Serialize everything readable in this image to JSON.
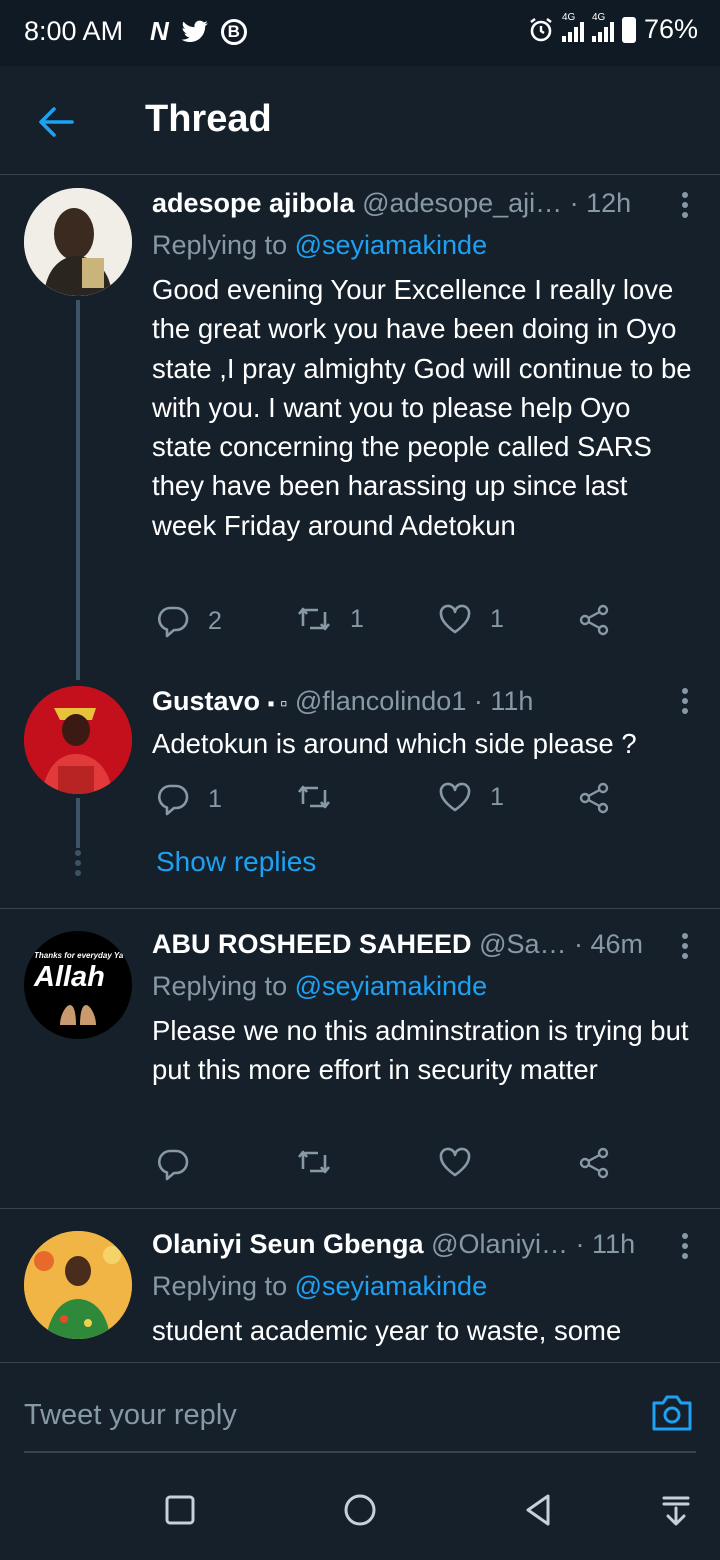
{
  "status_bar": {
    "time": "8:00 AM",
    "left_icons": [
      "news-icon",
      "twitter-icon",
      "b-icon"
    ],
    "signal_1_tag": "4G",
    "signal_2_tag": "4G",
    "battery": "76%"
  },
  "header": {
    "title": "Thread"
  },
  "tweets": [
    {
      "name": "adesope ajibola",
      "handle": "@adesope_aji…",
      "time": "· 12h",
      "replying_prefix": "Replying to ",
      "replying_to": "@seyiamakinde",
      "text": "Good evening Your Excellence I really love the great work you have been doing in Oyo state ,I pray almighty God will continue to be with you. I want you to please help Oyo state concerning the people called SARS they have been harassing up since last week Friday around Adetokun",
      "replies": "2",
      "retweets": "1",
      "likes": "1"
    },
    {
      "name": "Gustavo",
      "name_suffix": "▪ ▫",
      "handle": "@flancolindo1",
      "time": "· 11h",
      "text": "Adetokun is around which side please ?",
      "replies": "1",
      "retweets": "",
      "likes": "1"
    },
    {
      "name": "ABU ROSHEED SAHEED",
      "handle": "@Sa…",
      "time": "· 46m",
      "replying_prefix": "Replying to ",
      "replying_to": "@seyiamakinde",
      "avatar_top_text": "Thanks for everyday Ya",
      "avatar_main_text": "Allah",
      "text": "Please we no this adminstration is trying but put this more effort in security matter",
      "replies": "",
      "retweets": "",
      "likes": ""
    },
    {
      "name": "Olaniyi Seun Gbenga",
      "handle": "@Olaniyi…",
      "time": "· 11h",
      "replying_prefix": "Replying to ",
      "replying_to": "@seyiamakinde",
      "text": "student academic year to waste, some"
    }
  ],
  "show_replies": "Show replies",
  "reply_bar": {
    "placeholder": "Tweet your reply"
  },
  "colors": {
    "background": "#15202b",
    "accent": "#1da1f2",
    "muted": "#8899a6",
    "divider": "#38444d"
  }
}
